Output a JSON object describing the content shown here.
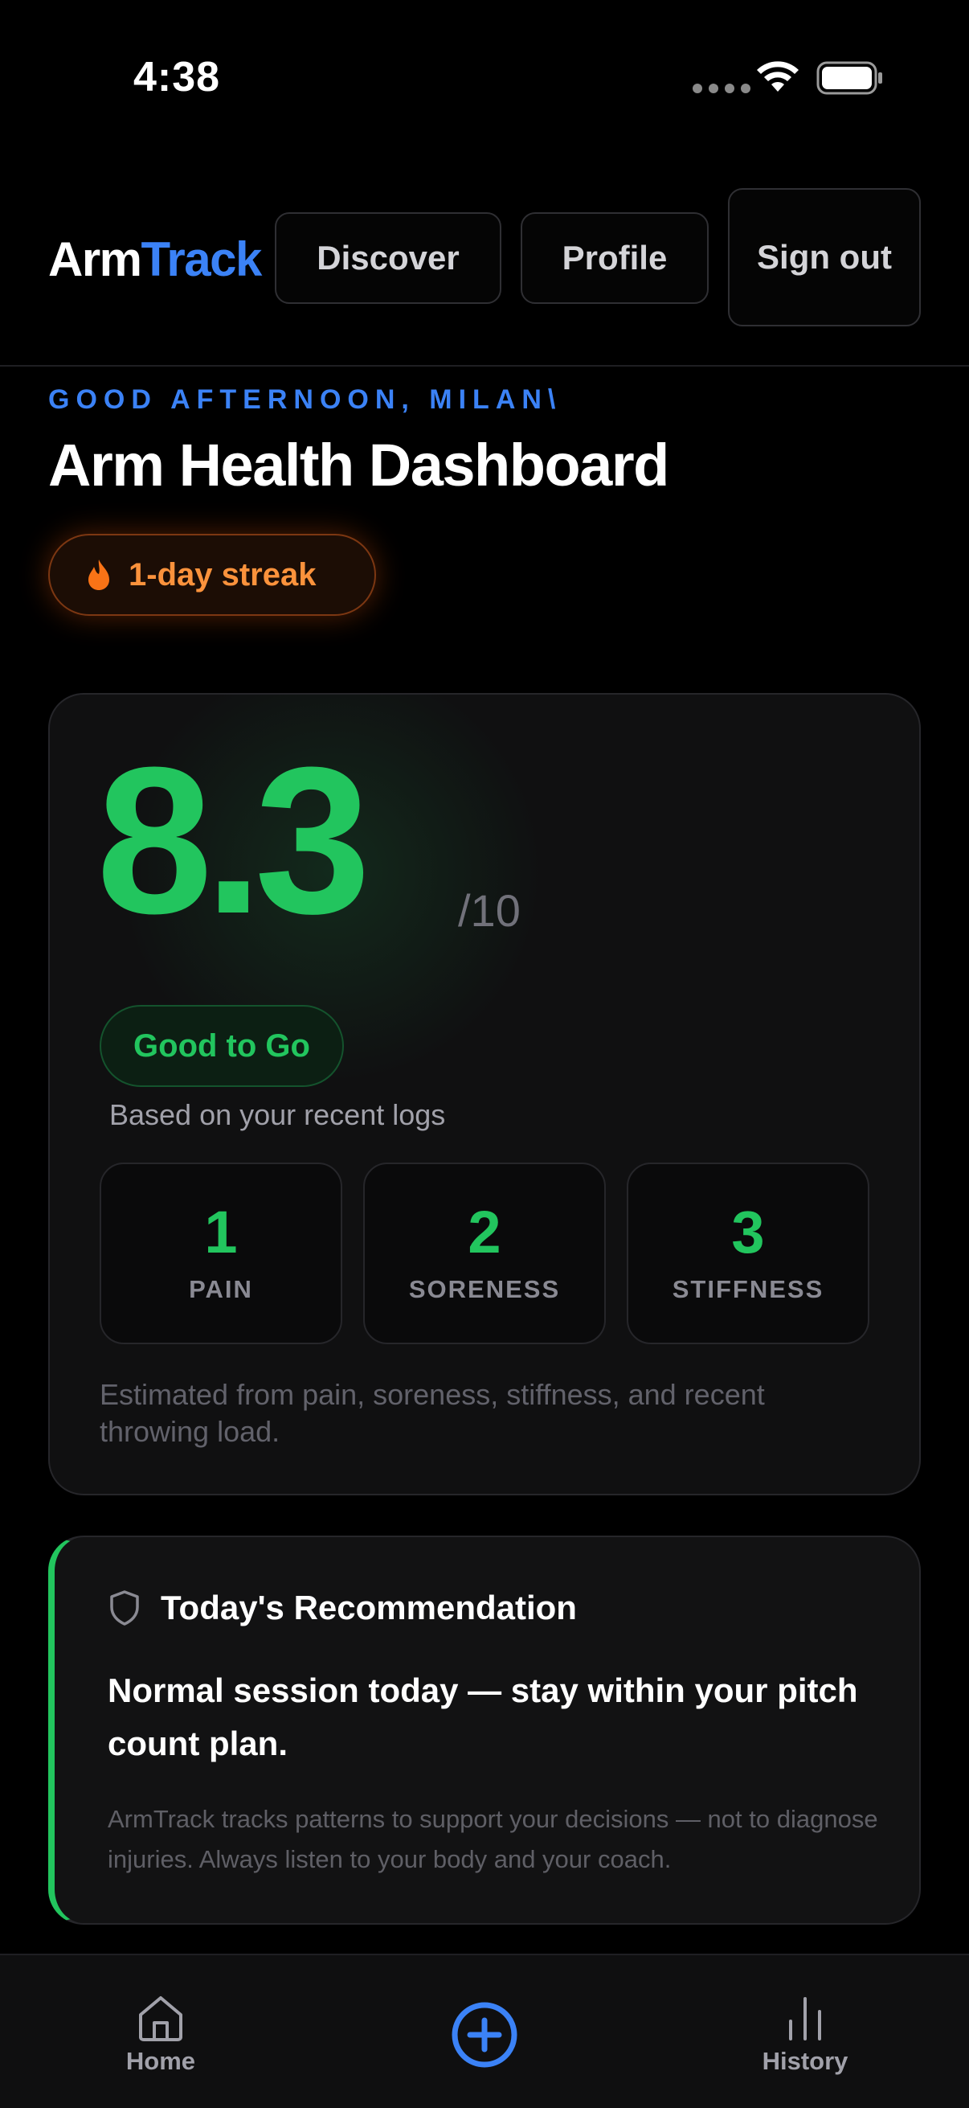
{
  "status_bar": {
    "time": "4:38"
  },
  "header": {
    "brand_part1": "Arm",
    "brand_part2": "Track",
    "buttons": {
      "discover": "Discover",
      "profile": "Profile",
      "sign_out": "Sign out"
    }
  },
  "greeting": "GOOD AFTERNOON, MILAN\\",
  "title": "Arm Health Dashboard",
  "streak": {
    "label": "1-day streak"
  },
  "score": {
    "value": "8.3",
    "max": "/10",
    "status": "Good to Go",
    "subtitle": "Based on your recent logs",
    "metrics": [
      {
        "value": "1",
        "label": "PAIN"
      },
      {
        "value": "2",
        "label": "SORENESS"
      },
      {
        "value": "3",
        "label": "STIFFNESS"
      }
    ],
    "note": "Estimated from pain, soreness, stiffness, and recent throwing load."
  },
  "recommendation": {
    "title": "Today's Recommendation",
    "text": "Normal session today — stay within your pitch count plan.",
    "note": "ArmTrack tracks patterns to support your decisions — not to diagnose injuries. Always listen to your body and your coach."
  },
  "tab_bar": {
    "home": "Home",
    "history": "History"
  },
  "colors": {
    "accent_blue": "#3b82f6",
    "good_green": "#22c55e",
    "streak_orange": "#fb923c"
  }
}
